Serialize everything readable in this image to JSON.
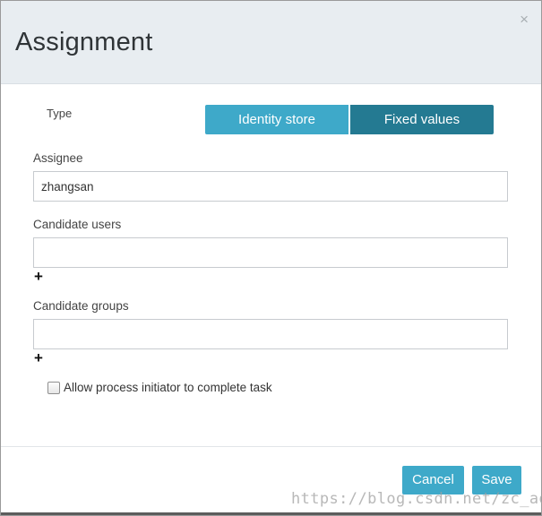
{
  "dialog": {
    "title": "Assignment",
    "close_icon": "×"
  },
  "type": {
    "label": "Type",
    "options": [
      "Identity store",
      "Fixed values"
    ],
    "selected": "Fixed values"
  },
  "assignee": {
    "label": "Assignee",
    "value": "zhangsan"
  },
  "candidate_users": {
    "label": "Candidate users",
    "value": "",
    "add_icon": "+"
  },
  "candidate_groups": {
    "label": "Candidate groups",
    "value": "",
    "add_icon": "+"
  },
  "allow_initiator": {
    "label": "Allow process initiator to complete task",
    "checked": false
  },
  "footer": {
    "cancel_label": "Cancel",
    "save_label": "Save"
  },
  "watermark": "https://blog.csdn.net/zc_ad",
  "colors": {
    "header_bg": "#e8edf1",
    "primary": "#3ea9c9",
    "primary_active": "#247a92"
  }
}
